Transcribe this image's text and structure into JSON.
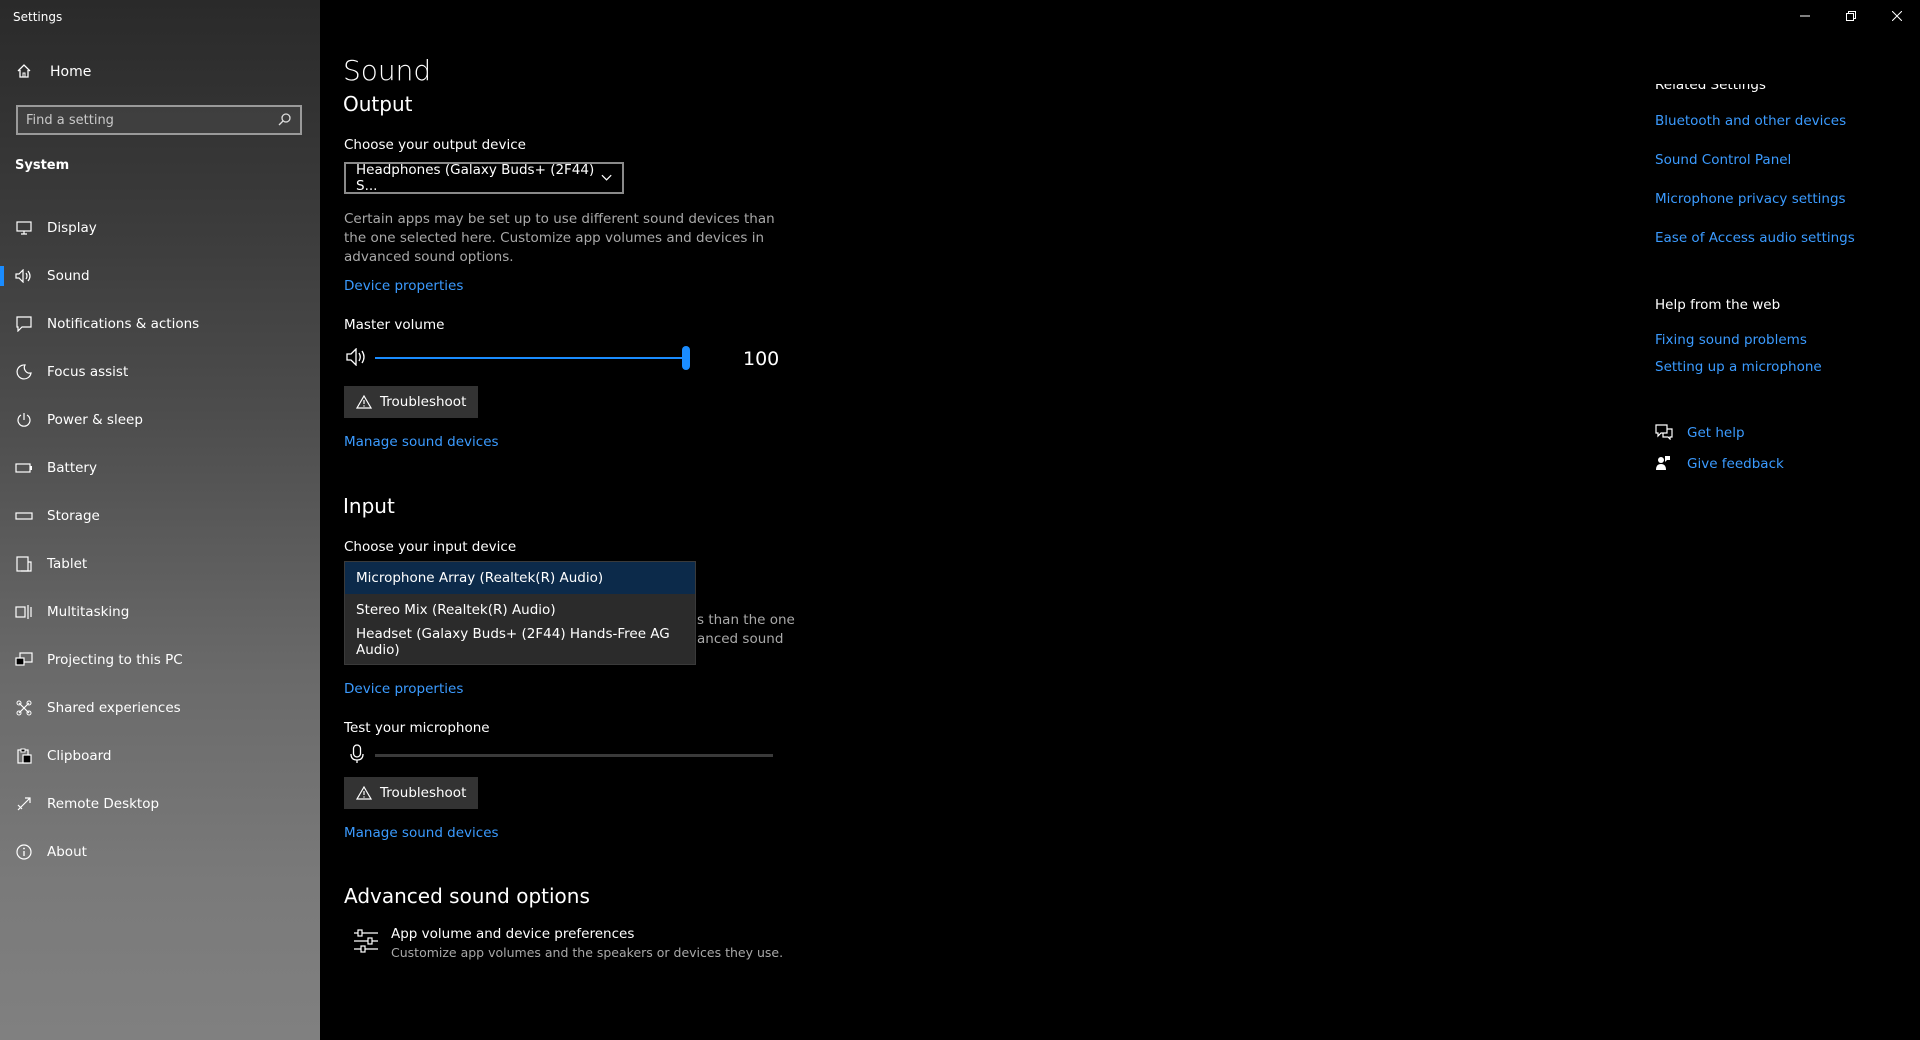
{
  "app": {
    "title": "Settings"
  },
  "sidebar": {
    "home_label": "Home",
    "search_placeholder": "Find a setting",
    "section": "System",
    "items": [
      {
        "label": "Display",
        "icon": "monitor-icon"
      },
      {
        "label": "Sound",
        "icon": "speaker-icon",
        "active": true
      },
      {
        "label": "Notifications & actions",
        "icon": "notification-icon"
      },
      {
        "label": "Focus assist",
        "icon": "moon-icon"
      },
      {
        "label": "Power & sleep",
        "icon": "power-icon"
      },
      {
        "label": "Battery",
        "icon": "battery-icon"
      },
      {
        "label": "Storage",
        "icon": "storage-icon"
      },
      {
        "label": "Tablet",
        "icon": "tablet-icon"
      },
      {
        "label": "Multitasking",
        "icon": "multitasking-icon"
      },
      {
        "label": "Projecting to this PC",
        "icon": "projecting-icon"
      },
      {
        "label": "Shared experiences",
        "icon": "shared-icon"
      },
      {
        "label": "Clipboard",
        "icon": "clipboard-icon"
      },
      {
        "label": "Remote Desktop",
        "icon": "remote-icon"
      },
      {
        "label": "About",
        "icon": "info-icon"
      }
    ]
  },
  "main": {
    "title": "Sound",
    "output": {
      "heading": "Output",
      "device_label": "Choose your output device",
      "device_value": "Headphones (Galaxy Buds+ (2F44) S...",
      "desc": "Certain apps may be set up to use different sound devices than the one selected here. Customize app volumes and devices in advanced sound options.",
      "device_properties": "Device properties",
      "master_volume_label": "Master volume",
      "volume": 100,
      "troubleshoot": "Troubleshoot",
      "manage": "Manage sound devices"
    },
    "input": {
      "heading": "Input",
      "device_label": "Choose your input device",
      "options": [
        "Microphone Array (Realtek(R) Audio)",
        "Stereo Mix (Realtek(R) Audio)",
        "Headset (Galaxy Buds+ (2F44) Hands-Free AG Audio)"
      ],
      "partial_1": "s than the one",
      "partial_2": "anced sound",
      "device_properties": "Device properties",
      "test_label": "Test your microphone",
      "troubleshoot": "Troubleshoot",
      "manage": "Manage sound devices"
    },
    "advanced": {
      "heading": "Advanced sound options",
      "item_title": "App volume and device preferences",
      "item_desc": "Customize app volumes and the speakers or devices they use."
    }
  },
  "right": {
    "related_heading": "Related Settings",
    "related_links": [
      "Bluetooth and other devices",
      "Sound Control Panel",
      "Microphone privacy settings",
      "Ease of Access audio settings"
    ],
    "help_heading": "Help from the web",
    "help_links": [
      "Fixing sound problems",
      "Setting up a microphone"
    ],
    "get_help": "Get help",
    "give_feedback": "Give feedback"
  },
  "colors": {
    "accent": "#1a8cff",
    "link": "#3b9bff"
  }
}
